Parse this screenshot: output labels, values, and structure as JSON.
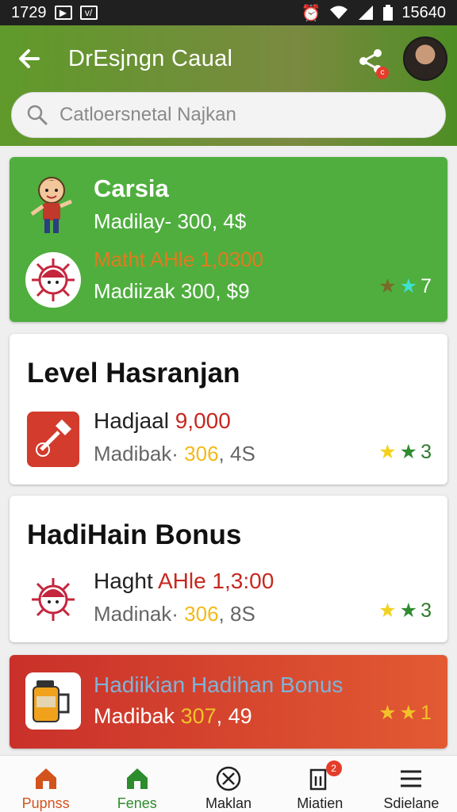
{
  "status_bar": {
    "time": "1729",
    "right_text": "15640",
    "icons": [
      "play-icon",
      "v-icon",
      "alarm-icon",
      "wifi-icon",
      "signal-icon",
      "battery-icon"
    ]
  },
  "header": {
    "title": "DrEsjngn Caual",
    "back_icon": "arrow-left-icon",
    "share_icon": "share-icon",
    "share_badge": "c",
    "avatar": "avatar"
  },
  "search": {
    "placeholder": "Catloersnetal Najkan",
    "icon": "search-icon"
  },
  "cards": [
    {
      "name": "Carsia",
      "sub": "Madilay- 300, 4$",
      "highlight": "Matht AHle 1,0300",
      "sub2": "Madiizak 300, $9",
      "stars": "7",
      "bg": "#4fae3e"
    },
    {
      "heading": "Level Hasranjan",
      "line1_prefix": "Hadjaal ",
      "line1_value": "9,000",
      "line2_prefix": "Madibak· ",
      "line2_value": "306",
      "line2_suffix": ", 4S",
      "stars": "3"
    },
    {
      "heading": "HadiHain Bonus",
      "line1_prefix": "Haght ",
      "line1_value": "AHle 1,3:00",
      "line2_prefix": "Madinak· ",
      "line2_value": "306",
      "line2_suffix": ", 8S",
      "stars": "3"
    },
    {
      "line1": "Hadiikian Hadihan Bonus",
      "line2_prefix": "Madibak ",
      "line2_value": "307",
      "line2_suffix": ", 49",
      "stars": "1"
    }
  ],
  "navbar": {
    "items": [
      {
        "label": "Pupnss",
        "icon": "home-icon"
      },
      {
        "label": "Fenes",
        "icon": "favorites-icon"
      },
      {
        "label": "Maklan",
        "icon": "close-circle-icon"
      },
      {
        "label": "Miatien",
        "icon": "notifications-icon",
        "badge": "2"
      },
      {
        "label": "Sdielane",
        "icon": "menu-icon"
      }
    ]
  },
  "colors": {
    "accent_green": "#4fae3e",
    "accent_red": "#c6281f",
    "accent_yellow": "#f3b919",
    "nav_home": "#d3531c"
  }
}
